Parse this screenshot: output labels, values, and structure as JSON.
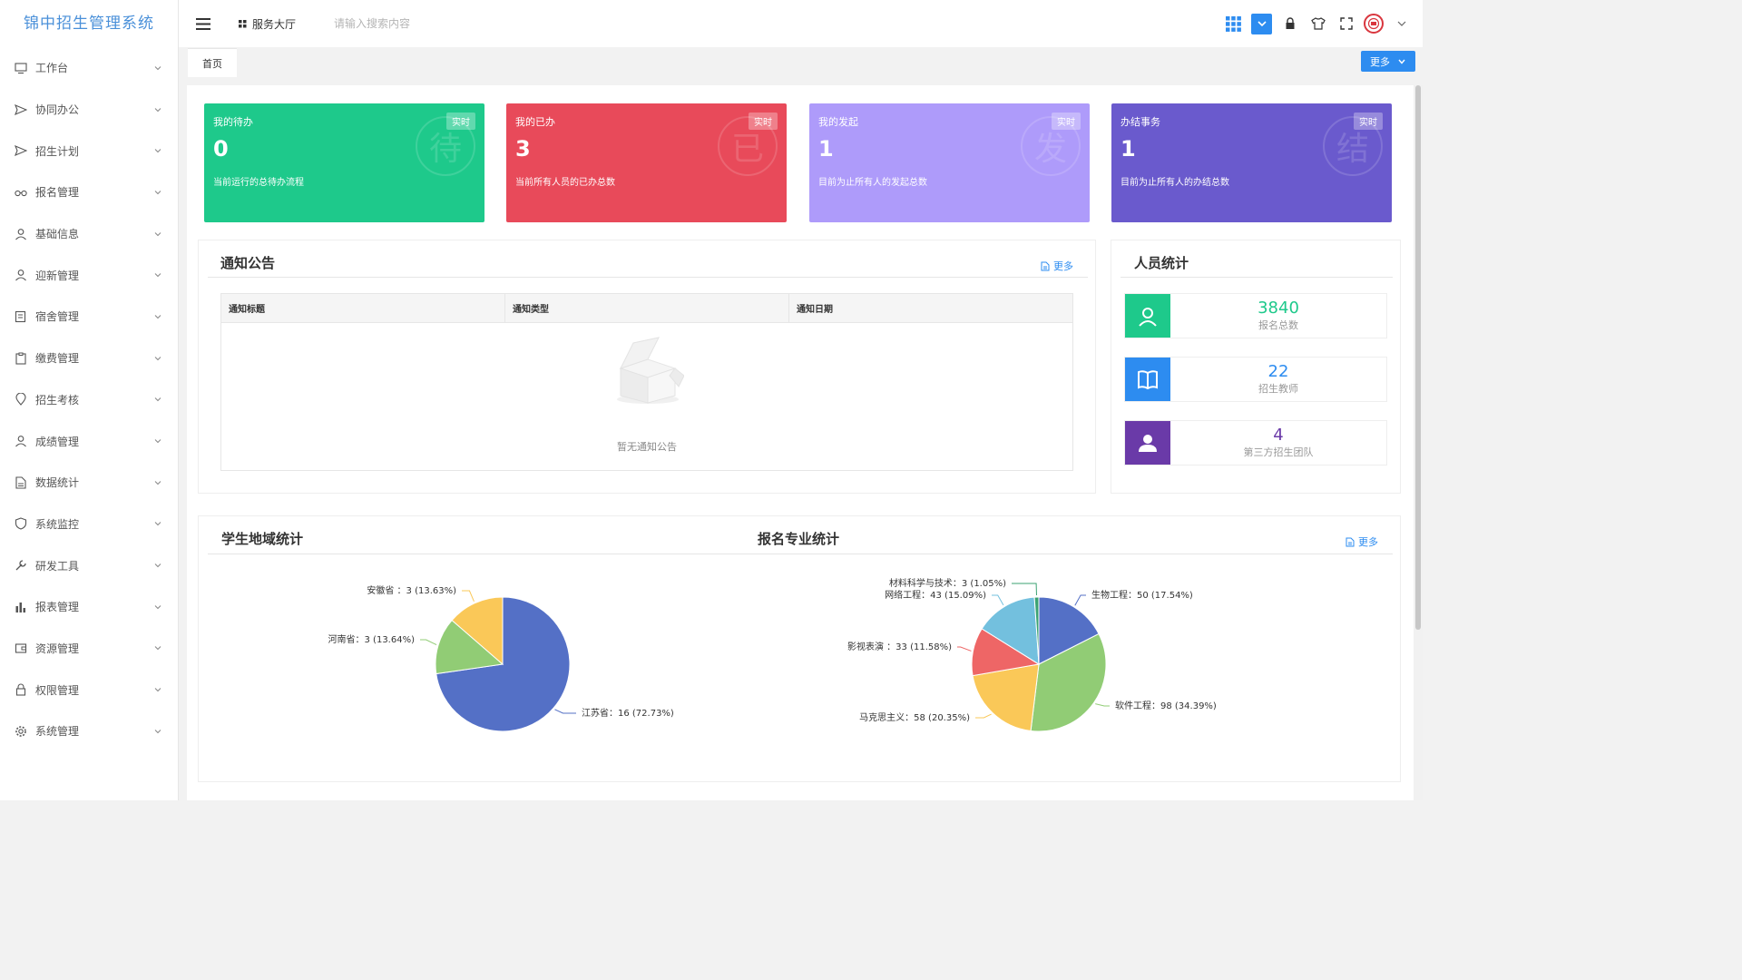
{
  "app": {
    "title": "锦中招生管理系统"
  },
  "sidebar": {
    "items": [
      {
        "label": "工作台",
        "icon": "monitor-icon"
      },
      {
        "label": "协同办公",
        "icon": "send-icon"
      },
      {
        "label": "招生计划",
        "icon": "send-icon"
      },
      {
        "label": "报名管理",
        "icon": "glasses-icon"
      },
      {
        "label": "基础信息",
        "icon": "user-icon"
      },
      {
        "label": "迎新管理",
        "icon": "user-icon"
      },
      {
        "label": "宿舍管理",
        "icon": "edit-icon"
      },
      {
        "label": "缴费管理",
        "icon": "clipboard-icon"
      },
      {
        "label": "招生考核",
        "icon": "location-icon"
      },
      {
        "label": "成绩管理",
        "icon": "user-icon"
      },
      {
        "label": "数据统计",
        "icon": "document-icon"
      },
      {
        "label": "系统监控",
        "icon": "shield-icon"
      },
      {
        "label": "研发工具",
        "icon": "tool-icon"
      },
      {
        "label": "报表管理",
        "icon": "bar-chart-icon"
      },
      {
        "label": "资源管理",
        "icon": "wallet-icon"
      },
      {
        "label": "权限管理",
        "icon": "lock-icon"
      },
      {
        "label": "系统管理",
        "icon": "gear-icon"
      }
    ]
  },
  "header": {
    "service_hall": "服务大厅",
    "search_placeholder": "请输入搜索内容"
  },
  "tabs": {
    "home": "首页",
    "more": "更多"
  },
  "cards": [
    {
      "title": "我的待办",
      "value": "0",
      "desc": "当前运行的总待办流程",
      "badge": "实时",
      "watermark": "待",
      "color": "#1ec98b"
    },
    {
      "title": "我的已办",
      "value": "3",
      "desc": "当前所有人员的已办总数",
      "badge": "实时",
      "watermark": "已",
      "color": "#e84a5a"
    },
    {
      "title": "我的发起",
      "value": "1",
      "desc": "目前为止所有人的发起总数",
      "badge": "实时",
      "watermark": "发",
      "color": "#ae9bfa"
    },
    {
      "title": "办结事务",
      "value": "1",
      "desc": "目前为止所有人的办结总数",
      "badge": "实时",
      "watermark": "结",
      "color": "#6a5acd"
    }
  ],
  "notice": {
    "title": "通知公告",
    "more": "更多",
    "columns": [
      "通知标题",
      "通知类型",
      "通知日期"
    ],
    "empty": "暂无通知公告"
  },
  "personnel": {
    "title": "人员统计",
    "rows": [
      {
        "value": "3840",
        "label": "报名总数",
        "color": "#1ec98b",
        "icon": "user-outline-icon"
      },
      {
        "value": "22",
        "label": "招生教师",
        "color": "#2d8cf0",
        "icon": "book-icon"
      },
      {
        "value": "4",
        "label": "第三方招生团队",
        "color": "#6a3aa8",
        "icon": "user-solid-icon"
      }
    ]
  },
  "charts": {
    "region_title": "学生地域统计",
    "major_title": "报名专业统计",
    "more": "更多"
  },
  "chart_data": [
    {
      "type": "pie",
      "title": "学生地域统计",
      "slices": [
        {
          "name": "江苏省",
          "value": 16,
          "label": "江苏省：16 (72.73%)",
          "color": "#5470c6"
        },
        {
          "name": "河南省",
          "value": 3,
          "label": "河南省：3 (13.64%)",
          "color": "#91cc75"
        },
        {
          "name": "安徽省",
          "value": 3,
          "label": "安徽省 ：3 (13.63%)",
          "color": "#fac858"
        }
      ]
    },
    {
      "type": "pie",
      "title": "报名专业统计",
      "slices": [
        {
          "name": "生物工程",
          "value": 50,
          "label": "生物工程：50 (17.54%)",
          "color": "#5470c6"
        },
        {
          "name": "软件工程",
          "value": 98,
          "label": "软件工程：98 (34.39%)",
          "color": "#91cc75"
        },
        {
          "name": "马克思主义",
          "value": 58,
          "label": "马克思主义：58 (20.35%)",
          "color": "#fac858"
        },
        {
          "name": "影视表演",
          "value": 33,
          "label": "影视表演 ：33 (11.58%)",
          "color": "#ee6666"
        },
        {
          "name": "网络工程",
          "value": 43,
          "label": "网络工程：43 (15.09%)",
          "color": "#73c0de"
        },
        {
          "name": "材料科学与技术",
          "value": 3,
          "label": "材料科学与技术：3 (1.05%)",
          "color": "#3ba272"
        }
      ]
    }
  ]
}
